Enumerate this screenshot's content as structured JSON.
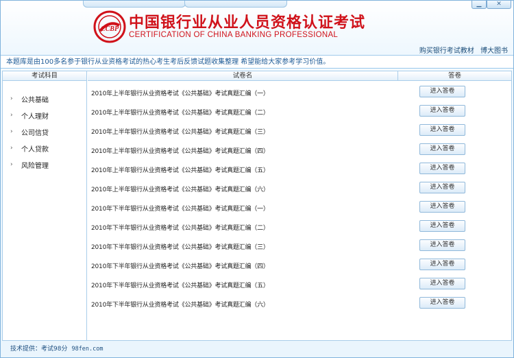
{
  "header": {
    "title_cn": "中国银行业从业人员资格认证考试",
    "title_en": "CERTIFICATION OF CHINA BANKING PROFESSIONAL",
    "logo_text": "CCBP",
    "links": [
      "购买银行考试教材",
      "博大图书"
    ],
    "window_buttons": [
      "minimize",
      "close"
    ]
  },
  "notice": "本题库是由100多名参于银行从业资格考试的热心考生考后反馈试题收集整理 希望能给大家参考学习价值。",
  "columns": {
    "subject": "考试科目",
    "paper": "试卷名",
    "answer": "答卷"
  },
  "sidebar": {
    "items": [
      {
        "label": "公共基础"
      },
      {
        "label": "个人理财"
      },
      {
        "label": "公司信贷"
      },
      {
        "label": "个人贷款"
      },
      {
        "label": "风险管理"
      }
    ]
  },
  "papers": [
    {
      "title": "2010年上半年银行从业资格考试《公共基础》考试真题汇编（一）",
      "button": "进入答卷"
    },
    {
      "title": "2010年上半年银行从业资格考试《公共基础》考试真题汇编（二）",
      "button": "进入答卷"
    },
    {
      "title": "2010年上半年银行从业资格考试《公共基础》考试真题汇编（三）",
      "button": "进入答卷"
    },
    {
      "title": "2010年上半年银行从业资格考试《公共基础》考试真题汇编（四）",
      "button": "进入答卷"
    },
    {
      "title": "2010年上半年银行从业资格考试《公共基础》考试真题汇编（五）",
      "button": "进入答卷"
    },
    {
      "title": "2010年上半年银行从业资格考试《公共基础》考试真题汇编（六）",
      "button": "进入答卷"
    },
    {
      "title": "2010年下半年银行从业资格考试《公共基础》考试真题汇编（一）",
      "button": "进入答卷"
    },
    {
      "title": "2010年下半年银行从业资格考试《公共基础》考试真题汇编（二）",
      "button": "进入答卷"
    },
    {
      "title": "2010年下半年银行从业资格考试《公共基础》考试真题汇编（三）",
      "button": "进入答卷"
    },
    {
      "title": "2010年下半年银行从业资格考试《公共基础》考试真题汇编（四）",
      "button": "进入答卷"
    },
    {
      "title": "2010年下半年银行从业资格考试《公共基础》考试真题汇编（五）",
      "button": "进入答卷"
    },
    {
      "title": "2010年下半年银行从业资格考试《公共基础》考试真题汇编（六）",
      "button": "进入答卷"
    }
  ],
  "footer": {
    "label": "技术提供：考试98分",
    "url": "98fen.com"
  },
  "colors": {
    "brand_red": "#d0121a",
    "accent_blue": "#1d5a96",
    "border_blue": "#a9cdea"
  }
}
